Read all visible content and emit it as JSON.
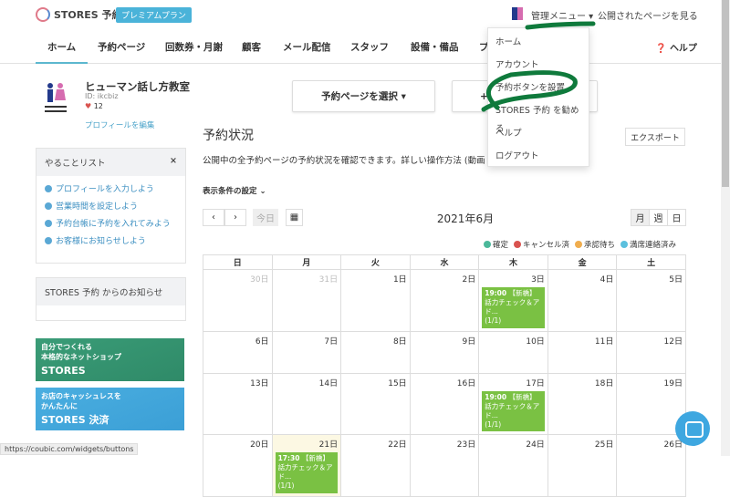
{
  "header": {
    "logo": "STORES 予約",
    "plan_badge": "プレミアムプラン",
    "admin_menu": "管理メニュー ▾",
    "public_page_link": "公開されたページを見る"
  },
  "nav": {
    "tabs": [
      "ホーム",
      "予約ページ",
      "回数券・月謝",
      "顧客",
      "メール配信",
      "スタッフ",
      "設備・備品",
      "プ"
    ],
    "help": "ヘルプ"
  },
  "profile": {
    "name": "ヒューマン話し方教室",
    "id": "ID: ikcbiz",
    "likes": "12",
    "edit_link": "プロフィールを編集"
  },
  "todo": {
    "title": "やることリスト",
    "items": [
      "プロフィールを入力しよう",
      "営業時間を設定しよう",
      "予約台帳に予約を入れてみよう",
      "お客様にお知らせしよう"
    ]
  },
  "news": {
    "title": "STORES 予約 からのお知らせ"
  },
  "banners": [
    {
      "line1": "自分でつくれる",
      "line2": "本格的なネットショップ",
      "brand": "STORES"
    },
    {
      "line1": "お店のキャッシュレスを",
      "line2": "かんたんに",
      "brand": "STORES 決済"
    }
  ],
  "main": {
    "select_page": "予約ページを選択 ▾",
    "add_button": "+",
    "title": "予約状況",
    "export": "エクスポート",
    "description": "公開中の全予約ページの予約状況を確認できます。詳しい操作方法 (動画",
    "filter": "表示条件の設定 ⌄"
  },
  "calendar": {
    "prev": "‹",
    "next": "›",
    "today": "今日",
    "month": "2021年6月",
    "views": [
      "月",
      "週",
      "日"
    ],
    "legend": [
      {
        "label": "確定",
        "color": "#4bb89a"
      },
      {
        "label": "キャンセル済",
        "color": "#d9534f"
      },
      {
        "label": "承認待ち",
        "color": "#f0ad4e"
      },
      {
        "label": "満席連絡済み",
        "color": "#5bc0de"
      }
    ],
    "weekdays": [
      "日",
      "月",
      "火",
      "水",
      "木",
      "金",
      "土"
    ],
    "weeks": [
      [
        "30日",
        "31日",
        "1日",
        "2日",
        "3日",
        "4日",
        "5日"
      ],
      [
        "6日",
        "7日",
        "8日",
        "9日",
        "10日",
        "11日",
        "12日"
      ],
      [
        "13日",
        "14日",
        "15日",
        "16日",
        "17日",
        "18日",
        "19日"
      ],
      [
        "20日",
        "21日",
        "22日",
        "23日",
        "24日",
        "25日",
        "26日"
      ]
    ],
    "events": [
      {
        "week": 0,
        "day": 4,
        "time": "19:00",
        "title": "【新橋】話力チェック＆アド...",
        "count": "(1/1)"
      },
      {
        "week": 2,
        "day": 4,
        "time": "19:00",
        "title": "【新橋】話力チェック＆アド...",
        "count": "(1/1)"
      },
      {
        "week": 3,
        "day": 1,
        "time": "17:30",
        "title": "【新橋】話力チェック＆アド...",
        "count": "(1/1)"
      }
    ]
  },
  "dropdown": {
    "items": [
      "ホーム",
      "アカウント",
      "予約ボタンを設置",
      "STORES 予約 を勧める",
      "ヘルプ",
      "ログアウト"
    ]
  },
  "status_bar": "https://coubic.com/widgets/buttons"
}
